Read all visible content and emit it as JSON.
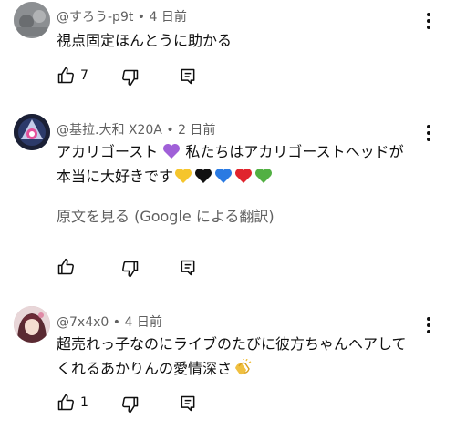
{
  "colors": {
    "purple_heart": "#a060d8",
    "yellow_heart": "#f5c52c",
    "black_heart": "#111111",
    "blue_heart": "#2a7ae2",
    "red_heart": "#e0242d",
    "green_heart": "#52b043",
    "clap": "#f0c040"
  },
  "comments": [
    {
      "author": "@すろう-p9t",
      "time": "4 日前",
      "lines": [
        "視点固定ほんとうに助かる"
      ],
      "likes": "7"
    },
    {
      "author": "@基拉.大和 X20A",
      "time": "2 日前",
      "line1_text": "アカリゴースト",
      "line1_rest": "私たちはアカリゴーストヘッドが",
      "line2_text": "本当に大好きです",
      "translate": "原文を見る (Google による翻訳)",
      "likes": ""
    },
    {
      "author": "@7x4x0",
      "time": "4 日前",
      "line1": "超売れっ子なのにライブのたびに彼方ちゃんヘアして",
      "line2_text": "くれるあかりんの愛情深さ",
      "likes": "1"
    }
  ],
  "separator": "•"
}
